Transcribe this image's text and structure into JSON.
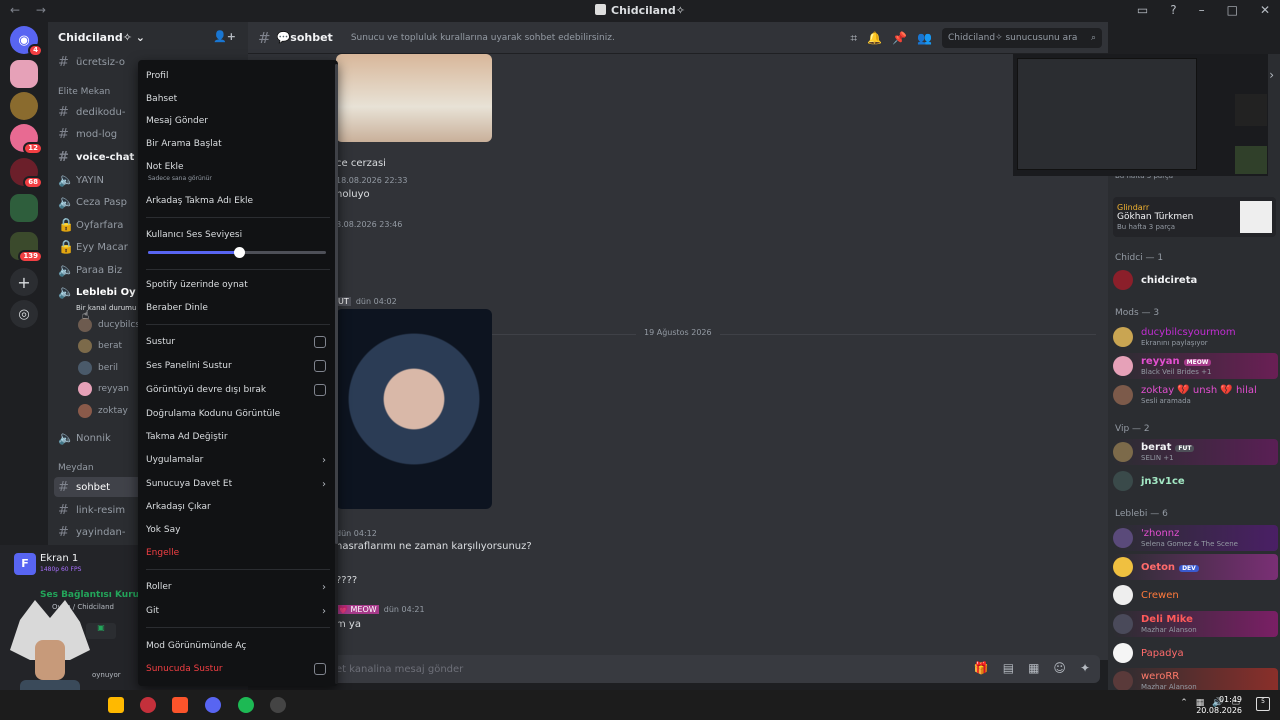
{
  "window": {
    "title": "Chidciland✧"
  },
  "server": {
    "name": "Chidciland✧"
  },
  "rail_badges": [
    "4",
    "12",
    "68",
    "139"
  ],
  "channels": {
    "top": "ücretsiz-o",
    "cat_elite": "Elite Mekan",
    "elite": [
      "dedikodu-",
      "mod-log",
      "voice-chat",
      "YAYIN",
      "Ceza Pasp",
      "Oyfarfara",
      "Eyy Macar",
      "Paraa Biz",
      "Leblebi Oy"
    ],
    "voice_hint": "Bir kanal durumu",
    "voice_users": [
      "ducybilcs",
      "berat",
      "beril",
      "reyyan",
      "zoktay"
    ],
    "nonnik": "Nonnik",
    "cat_meydan": "Meydan",
    "meydan": [
      "sohbet",
      "link-resim",
      "yayindan-"
    ]
  },
  "userpanel": {
    "screen_title": "Ekran 1",
    "screen_sub": "1480p 60 FPS",
    "voice_status": "Ses Bağlantısı Kuruldu",
    "voice_sub": "Oyun / Chidciland",
    "playing": "oynuyor"
  },
  "chat": {
    "channel": "sohbet",
    "topic": "Sunucu ve topluluk kurallarına uyarak sohbet edebilirsiniz.",
    "search_placeholder": "Chidciland✧ sunucusunu ara",
    "msg1_name": "ce cerzasi",
    "msg1_time": "18.08.2026 22:33",
    "msg1_text": "noluyo",
    "msg2_time": "8.08.2026 23:46",
    "day_sep": "19 Ağustos 2026",
    "msg3_tag": "UT",
    "msg3_time": "dün 04:02",
    "msg4_time": "dün 04:12",
    "msg4_text": "nasraflarımı ne zaman karşılıyorsunuz?",
    "msg4_text2": "????",
    "msg5_tag": "MEOW",
    "msg5_time": "dün 04:21",
    "msg5_text": "m ya",
    "composer_placeholder": "et kanalina mesaj gönder"
  },
  "members": {
    "activity1": "Bu hafta 3 parça",
    "glindarr": "Glindarr",
    "gokhan": "Gökhan Türkmen",
    "activity2": "Bu hafta 3 parça",
    "grp_chidci": "Chidci — 1",
    "chidcireta": "chidcireta",
    "grp_mods": "Mods — 3",
    "ducy": "ducybilcsyourmom",
    "ducy_sub": "Ekranını paylaşıyor",
    "reyyan": "reyyan",
    "reyyan_tag": "MEOW",
    "reyyan_sub": "Black Veil Brides +1",
    "zoktay": "zoktay 💔 unsh 💔 hilal",
    "zoktay_sub": "Sesli aramada",
    "grp_vip": "Vip — 2",
    "berat": "berat",
    "berat_tag": "FUT",
    "berat_sub": "SELIN +1",
    "jn3": "jn3v1ce",
    "grp_leblebi": "Leblebi — 6",
    "zhonnz": "'zhonnz",
    "zhonnz_sub": "Selena Gomez & The Scene",
    "oeton": "Oeton",
    "oeton_tag": "DEV",
    "crewen": "Crewen",
    "deli": "Deli Mike",
    "deli_sub": "Mazhar Alanson",
    "papadya": "Papadya",
    "wero": "weroRR",
    "wero_sub": "Mazhar Alanson"
  },
  "context_menu": {
    "profil": "Profil",
    "bahset": "Bahset",
    "mesaj": "Mesaj Gönder",
    "arama": "Bir Arama Başlat",
    "not": "Not Ekle",
    "not_sub": "Sadece sana görünür",
    "takma": "Arkadaş Takma Adı Ekle",
    "ses": "Kullanıcı Ses Seviyesi",
    "volume": 0.51,
    "spotify": "Spotify üzerinde oynat",
    "dinle": "Beraber Dinle",
    "sustur": "Sustur",
    "panel": "Ses Panelini Sustur",
    "goruntu": "Görüntüyü devre dışı bırak",
    "dogrulama": "Doğrulama Kodunu Görüntüle",
    "takmaad": "Takma Ad Değiştir",
    "uygulamalar": "Uygulamalar",
    "davet": "Sunucuya Davet Et",
    "cikar": "Arkadaşı Çıkar",
    "yoksay": "Yok Say",
    "engelle": "Engelle",
    "roller": "Roller",
    "git": "Git",
    "mod": "Mod Görünümünde Aç",
    "sunucuda": "Sunucuda Sustur"
  },
  "taskbar": {
    "time": "01:49",
    "date": "20.08.2026",
    "notif": "5"
  },
  "colors": {
    "accent": "#5865f2",
    "danger": "#f23f43",
    "green": "#23a55a"
  }
}
